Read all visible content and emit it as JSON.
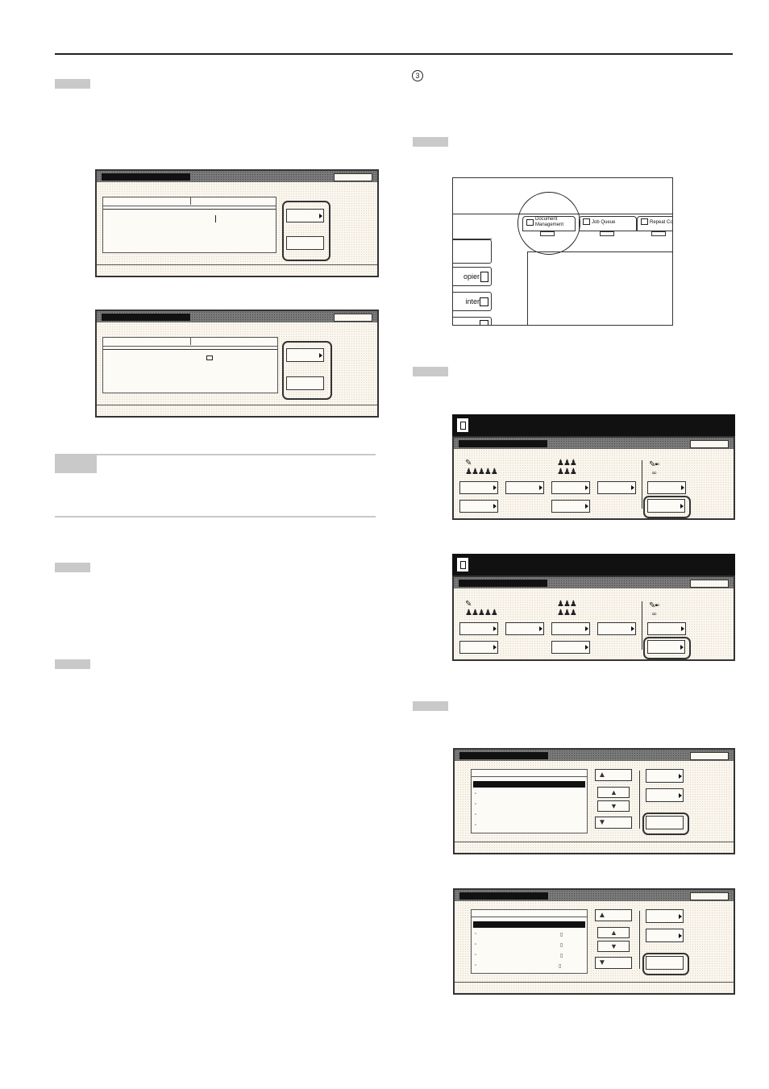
{
  "circled_step_number": "3",
  "touch_panel": {
    "tabs": [
      "Document Management",
      "Job Queue",
      "Repeat Co"
    ],
    "side_keys": [
      "opier",
      "inter"
    ]
  }
}
